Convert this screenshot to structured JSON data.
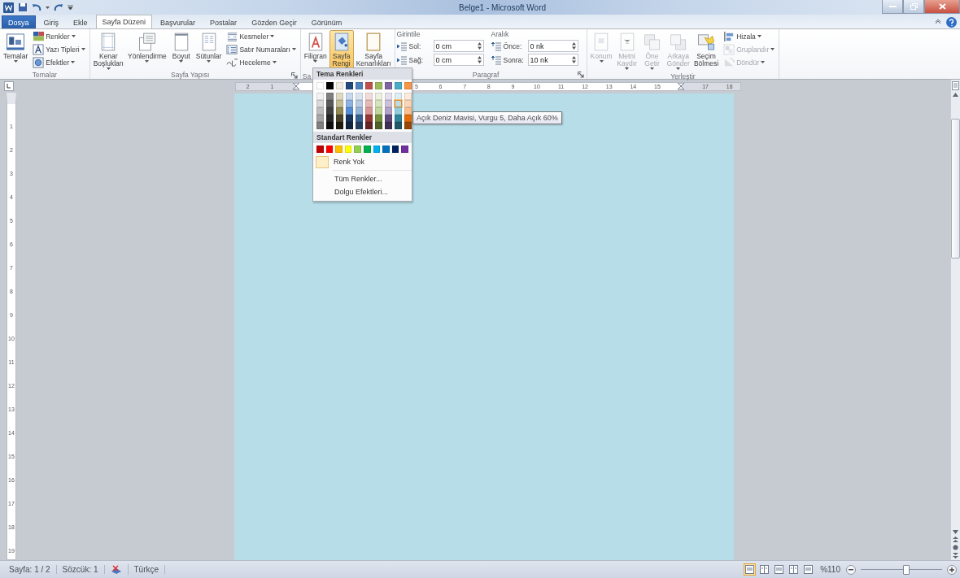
{
  "window": {
    "title": "Belge1 - Microsoft Word"
  },
  "tabs": [
    {
      "label": "Dosya",
      "kind": "file",
      "selected": false
    },
    {
      "label": "Giriş",
      "kind": "tab",
      "selected": false
    },
    {
      "label": "Ekle",
      "kind": "tab",
      "selected": false
    },
    {
      "label": "Sayfa Düzeni",
      "kind": "tab",
      "selected": true
    },
    {
      "label": "Başvurular",
      "kind": "tab",
      "selected": false
    },
    {
      "label": "Postalar",
      "kind": "tab",
      "selected": false
    },
    {
      "label": "Gözden Geçir",
      "kind": "tab",
      "selected": false
    },
    {
      "label": "Görünüm",
      "kind": "tab",
      "selected": false
    }
  ],
  "ribbon": {
    "groups": [
      {
        "kind": "buttons",
        "label": "Temalar",
        "label_cut": false,
        "launcher": false,
        "items": [
          {
            "kind": "big",
            "label": "Temalar",
            "dropdown": true,
            "pressed": false,
            "disabled": false
          },
          {
            "kind": "small",
            "label": "Renkler",
            "dropdown": true,
            "pressed": false,
            "disabled": false
          },
          {
            "kind": "small",
            "label": "Yazı Tipleri",
            "dropdown": true,
            "pressed": false,
            "disabled": false
          },
          {
            "kind": "small",
            "label": "Efektler",
            "dropdown": true,
            "pressed": false,
            "disabled": false
          }
        ]
      },
      {
        "kind": "buttons",
        "label": "Sayfa Yapısı",
        "label_cut": false,
        "launcher": true,
        "items": [
          {
            "kind": "big",
            "label": "Kenar Boşlukları",
            "dropdown": true,
            "pressed": false,
            "disabled": false
          },
          {
            "kind": "big",
            "label": "Yönlendirme",
            "dropdown": true,
            "pressed": false,
            "disabled": false
          },
          {
            "kind": "big",
            "label": "Boyut",
            "dropdown": true,
            "pressed": false,
            "disabled": false
          },
          {
            "kind": "big",
            "label": "Sütunlar",
            "dropdown": true,
            "pressed": false,
            "disabled": false
          },
          {
            "kind": "small",
            "label": "Kesmeler",
            "dropdown": true,
            "pressed": false,
            "disabled": false
          },
          {
            "kind": "small",
            "label": "Satır Numaraları",
            "dropdown": true,
            "pressed": false,
            "disabled": false
          },
          {
            "kind": "small",
            "label": "Heceleme",
            "dropdown": true,
            "pressed": false,
            "disabled": false
          }
        ]
      },
      {
        "kind": "buttons",
        "label": "Sa",
        "label_cut": true,
        "launcher": false,
        "items": [
          {
            "kind": "big",
            "label": "Filigran",
            "dropdown": true,
            "pressed": false,
            "disabled": false
          },
          {
            "kind": "big",
            "label": "Sayfa Rengi",
            "dropdown": true,
            "pressed": true,
            "disabled": false
          },
          {
            "kind": "big",
            "label": "Sayfa Kenarlıkları",
            "dropdown": false,
            "pressed": false,
            "disabled": false
          }
        ]
      },
      {
        "kind": "paragraph",
        "label": "Paragraf",
        "label_cut": false,
        "launcher": true,
        "sections": [
          {
            "title": "Girintile",
            "fields": [
              {
                "label": "Sol:",
                "value": "0 cm"
              },
              {
                "label": "Sağ:",
                "value": "0 cm"
              }
            ]
          },
          {
            "title": "Aralık",
            "fields": [
              {
                "label": "Önce:",
                "value": "0 nk"
              },
              {
                "label": "Sonra:",
                "value": "10 nk"
              }
            ]
          }
        ]
      },
      {
        "kind": "buttons",
        "label": "Yerleştir",
        "label_cut": false,
        "launcher": false,
        "items": [
          {
            "kind": "big",
            "label": "Konum",
            "dropdown": true,
            "pressed": false,
            "disabled": true
          },
          {
            "kind": "big",
            "label": "Metni Kaydır",
            "dropdown": true,
            "pressed": false,
            "disabled": true
          },
          {
            "kind": "big",
            "label": "Öne Getir",
            "dropdown": true,
            "pressed": false,
            "disabled": true
          },
          {
            "kind": "big",
            "label": "Arkaya Gönder",
            "dropdown": true,
            "pressed": false,
            "disabled": true
          },
          {
            "kind": "big",
            "label": "Seçim Bölmesi",
            "dropdown": false,
            "pressed": false,
            "disabled": false
          },
          {
            "kind": "small",
            "label": "Hizala",
            "dropdown": true,
            "pressed": false,
            "disabled": false
          },
          {
            "kind": "small",
            "label": "Gruplandır",
            "dropdown": true,
            "pressed": false,
            "disabled": true
          },
          {
            "kind": "small",
            "label": "Döndür",
            "dropdown": true,
            "pressed": false,
            "disabled": true
          }
        ]
      }
    ]
  },
  "ruler": [
    {
      "kind": "number",
      "label": "2"
    },
    {
      "kind": "number",
      "label": "1"
    },
    {
      "kind": "margin"
    },
    {
      "kind": "blank"
    },
    {
      "kind": "blank"
    },
    {
      "kind": "blank"
    },
    {
      "kind": "blank"
    },
    {
      "kind": "number",
      "label": "5"
    },
    {
      "kind": "number",
      "label": "6"
    },
    {
      "kind": "number",
      "label": "7"
    },
    {
      "kind": "number",
      "label": "8"
    },
    {
      "kind": "number",
      "label": "9"
    },
    {
      "kind": "number",
      "label": "10"
    },
    {
      "kind": "number",
      "label": "11"
    },
    {
      "kind": "number",
      "label": "12"
    },
    {
      "kind": "number",
      "label": "13"
    },
    {
      "kind": "number",
      "label": "14"
    },
    {
      "kind": "number",
      "label": "15"
    },
    {
      "kind": "margin"
    },
    {
      "kind": "number",
      "label": "17"
    },
    {
      "kind": "number",
      "label": "18"
    }
  ],
  "vertical_ruler": [
    "1",
    "2",
    "3",
    "4",
    "5",
    "6",
    "7",
    "8",
    "9",
    "10",
    "11",
    "12",
    "13",
    "14",
    "15",
    "16",
    "17",
    "18",
    "19"
  ],
  "page_color_menu": {
    "theme_title": "Tema Renkleri",
    "theme_colors": [
      {
        "color": "#ffffff",
        "shades": [
          {
            "color": "#f2f2f2",
            "hovered": false
          },
          {
            "color": "#d9d9d9",
            "hovered": false
          },
          {
            "color": "#bfbfbf",
            "hovered": false
          },
          {
            "color": "#a6a6a6",
            "hovered": false
          },
          {
            "color": "#7f7f7f",
            "hovered": false
          }
        ]
      },
      {
        "color": "#000000",
        "shades": [
          {
            "color": "#7f7f7f",
            "hovered": false
          },
          {
            "color": "#595959",
            "hovered": false
          },
          {
            "color": "#404040",
            "hovered": false
          },
          {
            "color": "#262626",
            "hovered": false
          },
          {
            "color": "#0d0d0d",
            "hovered": false
          }
        ]
      },
      {
        "color": "#eeece1",
        "shades": [
          {
            "color": "#ddd9c3",
            "hovered": false
          },
          {
            "color": "#c4bd97",
            "hovered": false
          },
          {
            "color": "#938953",
            "hovered": false
          },
          {
            "color": "#494429",
            "hovered": false
          },
          {
            "color": "#1d1b10",
            "hovered": false
          }
        ]
      },
      {
        "color": "#1f497d",
        "shades": [
          {
            "color": "#c6d9f0",
            "hovered": false
          },
          {
            "color": "#8db3e2",
            "hovered": false
          },
          {
            "color": "#548dd4",
            "hovered": false
          },
          {
            "color": "#17365d",
            "hovered": false
          },
          {
            "color": "#0f243e",
            "hovered": false
          }
        ]
      },
      {
        "color": "#4f81bd",
        "shades": [
          {
            "color": "#dbe5f1",
            "hovered": false
          },
          {
            "color": "#b8cce4",
            "hovered": false
          },
          {
            "color": "#95b3d7",
            "hovered": false
          },
          {
            "color": "#366092",
            "hovered": false
          },
          {
            "color": "#244061",
            "hovered": false
          }
        ]
      },
      {
        "color": "#c0504d",
        "shades": [
          {
            "color": "#f2dcdb",
            "hovered": false
          },
          {
            "color": "#e5b9b7",
            "hovered": false
          },
          {
            "color": "#d99694",
            "hovered": false
          },
          {
            "color": "#953734",
            "hovered": false
          },
          {
            "color": "#632423",
            "hovered": false
          }
        ]
      },
      {
        "color": "#9bbb59",
        "shades": [
          {
            "color": "#ebf1dd",
            "hovered": false
          },
          {
            "color": "#d7e3bc",
            "hovered": false
          },
          {
            "color": "#c3d69b",
            "hovered": false
          },
          {
            "color": "#76923c",
            "hovered": false
          },
          {
            "color": "#4f6128",
            "hovered": false
          }
        ]
      },
      {
        "color": "#8064a2",
        "shades": [
          {
            "color": "#e5e0ec",
            "hovered": false
          },
          {
            "color": "#ccc1d9",
            "hovered": false
          },
          {
            "color": "#b2a2c7",
            "hovered": false
          },
          {
            "color": "#5f497a",
            "hovered": false
          },
          {
            "color": "#3f3151",
            "hovered": false
          }
        ]
      },
      {
        "color": "#4bacc6",
        "shades": [
          {
            "color": "#dbeef3",
            "hovered": false
          },
          {
            "color": "#b7dde8",
            "hovered": true
          },
          {
            "color": "#92cddc",
            "hovered": false
          },
          {
            "color": "#31859b",
            "hovered": false
          },
          {
            "color": "#205867",
            "hovered": false
          }
        ]
      },
      {
        "color": "#f79646",
        "shades": [
          {
            "color": "#fdeada",
            "hovered": false
          },
          {
            "color": "#fbd5b5",
            "hovered": false
          },
          {
            "color": "#fac08f",
            "hovered": false
          },
          {
            "color": "#e36c09",
            "hovered": false
          },
          {
            "color": "#974806",
            "hovered": false
          }
        ]
      }
    ],
    "standard_title": "Standart Renkler",
    "standard_colors": [
      {
        "color": "#c00000"
      },
      {
        "color": "#ff0000"
      },
      {
        "color": "#ffc000"
      },
      {
        "color": "#ffff00"
      },
      {
        "color": "#92d050"
      },
      {
        "color": "#00b050"
      },
      {
        "color": "#00b0f0"
      },
      {
        "color": "#0070c0"
      },
      {
        "color": "#002060"
      },
      {
        "color": "#7030a0"
      }
    ],
    "items": [
      {
        "kind": "no-color",
        "label": "Renk Yok"
      },
      {
        "kind": "command",
        "label": "Tüm Renkler..."
      },
      {
        "kind": "command",
        "label": "Dolgu Efektleri..."
      }
    ]
  },
  "tooltip": "Açık Deniz Mavisi, Vurgu 5, Daha Açık 60%",
  "status_bar": {
    "left": [
      {
        "kind": "text",
        "label": "Sayfa: 1 / 2"
      },
      {
        "kind": "text",
        "label": "Sözcük: 1"
      },
      {
        "kind": "proofing"
      },
      {
        "kind": "text",
        "label": "Türkçe"
      }
    ],
    "views": [
      {
        "selected": true
      },
      {
        "selected": false
      },
      {
        "selected": false
      },
      {
        "selected": false
      },
      {
        "selected": false
      }
    ],
    "zoom": "%110",
    "level": 0.55
  }
}
